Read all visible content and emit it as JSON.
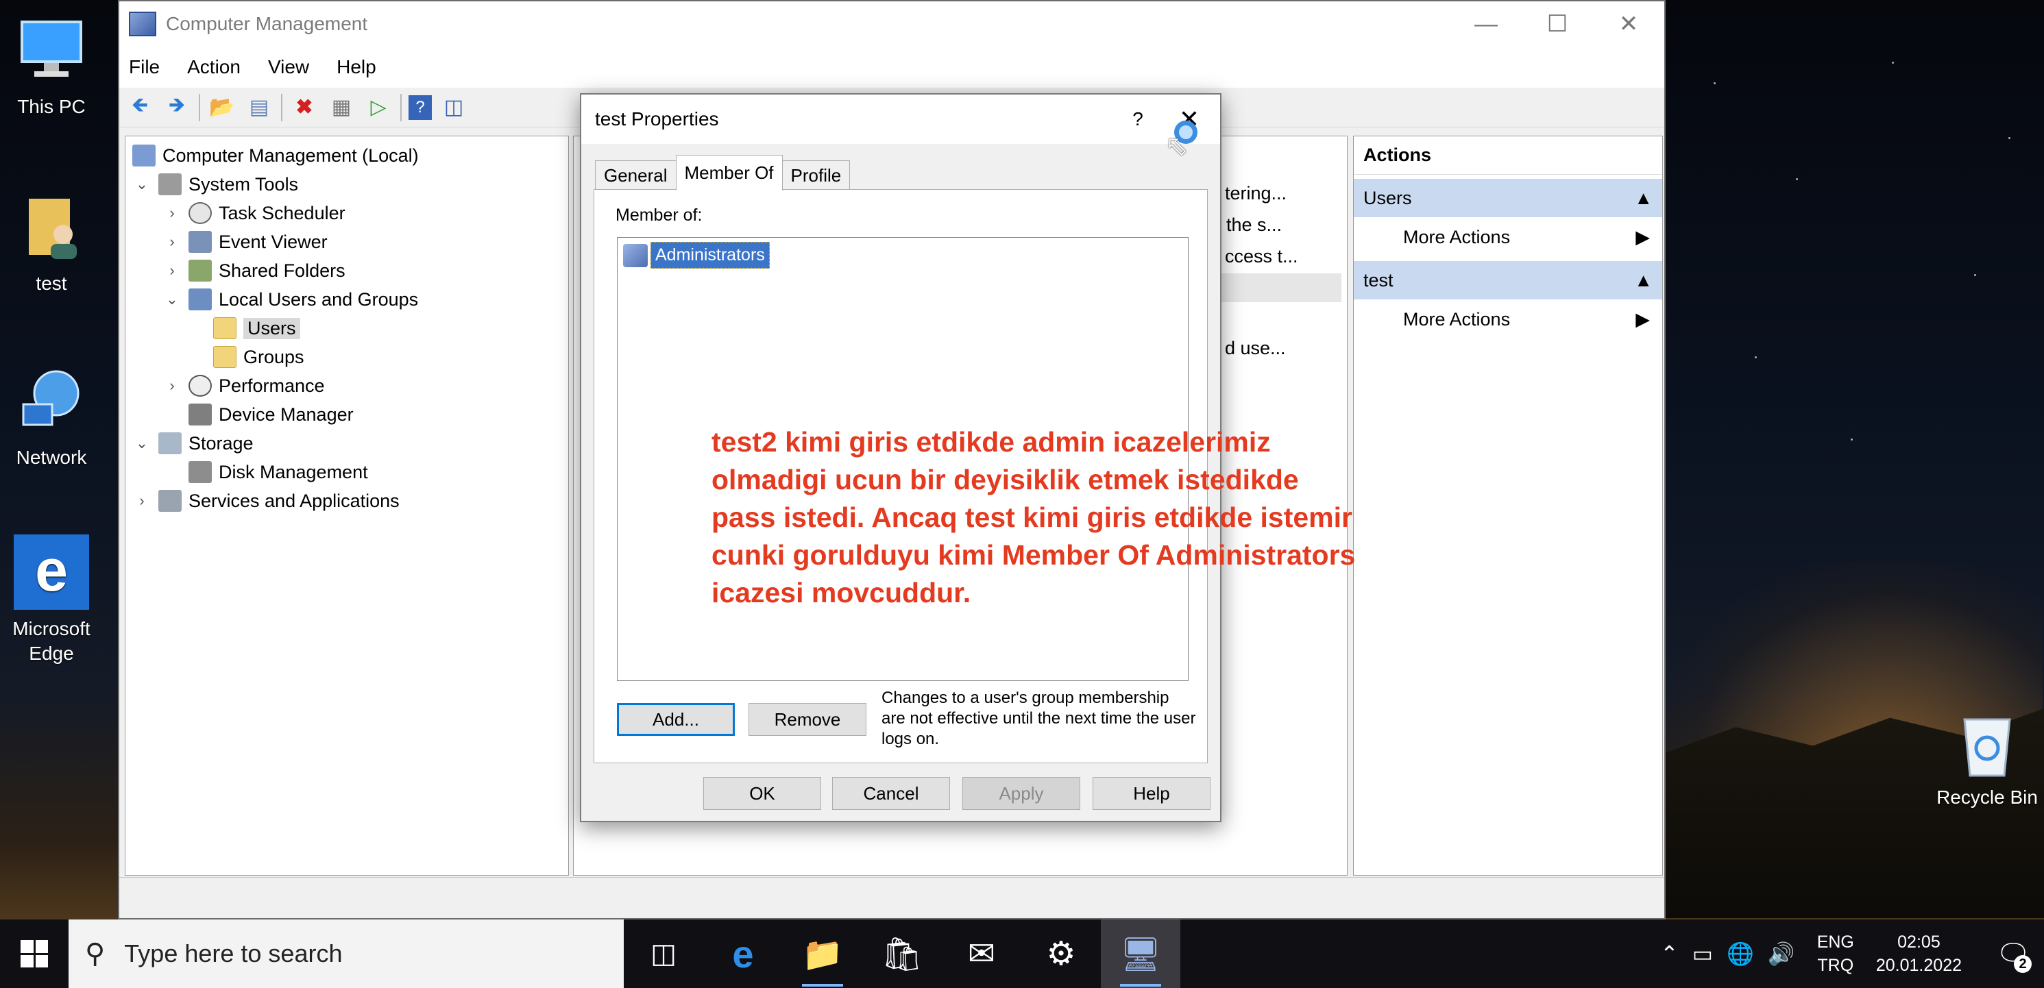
{
  "desktop": {
    "icons": [
      {
        "label": "This PC"
      },
      {
        "label": "test"
      },
      {
        "label": "Network"
      },
      {
        "label": "Microsoft Edge"
      },
      {
        "label": "Recycle Bin"
      }
    ]
  },
  "window": {
    "title": "Computer Management",
    "menu": [
      "File",
      "Action",
      "View",
      "Help"
    ],
    "tree": [
      "Computer Management (Local)",
      "System Tools",
      "Task Scheduler",
      "Event Viewer",
      "Shared Folders",
      "Local Users and Groups",
      "Users",
      "Groups",
      "Performance",
      "Device Manager",
      "Storage",
      "Disk Management",
      "Services and Applications"
    ],
    "center_fragments": [
      "tering...",
      "the s...",
      "ccess t...",
      "d use..."
    ],
    "actions": {
      "header": "Actions",
      "sections": [
        {
          "title": "Users",
          "item": "More Actions"
        },
        {
          "title": "test",
          "item": "More Actions"
        }
      ]
    }
  },
  "dialog": {
    "title": "test Properties",
    "help": "?",
    "tabs": [
      "General",
      "Member Of",
      "Profile"
    ],
    "member_of_label": "Member of:",
    "members": [
      "Administrators"
    ],
    "add_button": "Add...",
    "remove_button": "Remove",
    "note": "Changes to a user's group membership are not effective until the next time the user logs on.",
    "ok": "OK",
    "cancel": "Cancel",
    "apply": "Apply",
    "help_button": "Help"
  },
  "annotation": {
    "lines": [
      "test2 kimi giris etdikde admin icazelerimiz",
      "olmadigi ucun bir deyisiklik etmek istedikde",
      "pass istedi. Ancaq test kimi giris etdikde istemir",
      "cunki gorulduyu kimi Member Of Administrators",
      "icazesi movcuddur."
    ],
    "color": "#e43a20"
  },
  "taskbar": {
    "search_placeholder": "Type here to search",
    "lang_top": "ENG",
    "lang_bottom": "TRQ",
    "time": "02:05",
    "date": "20.01.2022",
    "notifications": "2"
  }
}
